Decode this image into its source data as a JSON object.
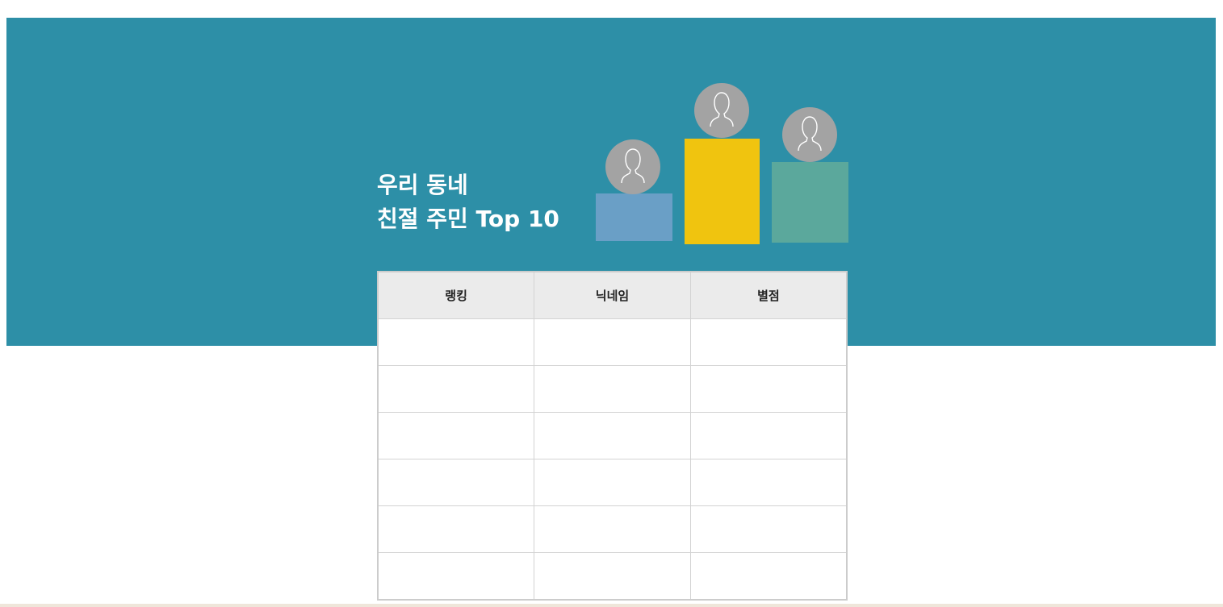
{
  "banner": {
    "title_line1": "우리 동네",
    "title_line2": "친절 주민 Top 10",
    "background_color": "#2d8fa7"
  },
  "podium": {
    "colors": {
      "left": "#6a9fc6",
      "center": "#f0c40f",
      "right": "#5ba89c"
    },
    "avatar_icon": "user-silhouette-icon"
  },
  "ranking_table": {
    "headers": [
      "랭킹",
      "닉네임",
      "별점"
    ],
    "rows": [
      [
        "",
        "",
        ""
      ],
      [
        "",
        "",
        ""
      ],
      [
        "",
        "",
        ""
      ],
      [
        "",
        "",
        ""
      ],
      [
        "",
        "",
        ""
      ],
      [
        "",
        "",
        ""
      ]
    ]
  }
}
